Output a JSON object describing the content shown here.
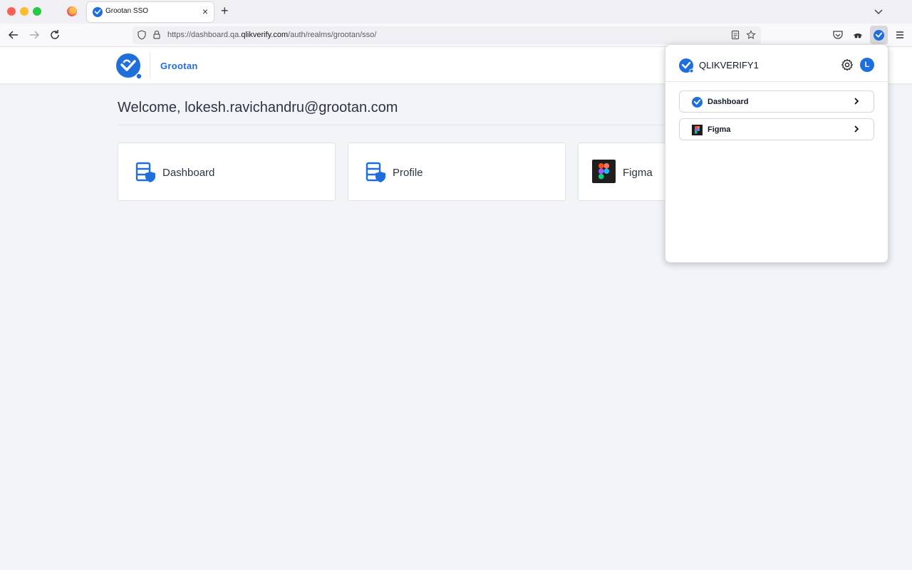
{
  "browser": {
    "tab_title": "Grootan SSO",
    "url_prefix": "https://dashboard.qa.",
    "url_domain": "qlikverify.com",
    "url_path": "/auth/realms/grootan/sso/"
  },
  "app": {
    "name": "Grootan",
    "welcome": "Welcome, lokesh.ravichandru@grootan.com",
    "cards": [
      {
        "label": "Dashboard",
        "icon": "server-shield-icon"
      },
      {
        "label": "Profile",
        "icon": "server-shield-icon"
      },
      {
        "label": "Figma",
        "icon": "figma-icon"
      }
    ]
  },
  "popup": {
    "title": "QLIKVERIFY1",
    "avatar_letter": "L",
    "items": [
      {
        "label": "Dashboard",
        "icon": "qlikverify-icon"
      },
      {
        "label": "Figma",
        "icon": "figma-icon"
      }
    ]
  },
  "colors": {
    "accent": "#1e6fdc",
    "page_bg": "#f3f4f8"
  }
}
